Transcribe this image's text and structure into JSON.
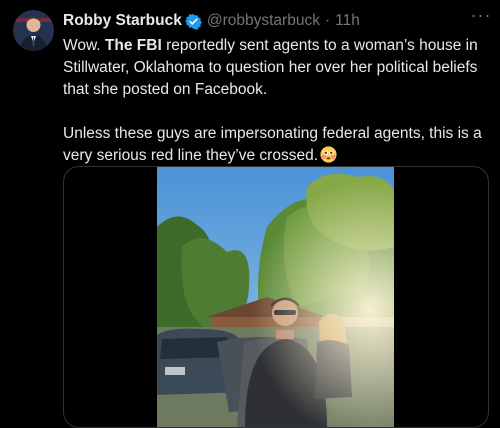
{
  "tweet": {
    "author_name": "Robby Starbuck",
    "handle": "@robbystarbuck",
    "separator": "·",
    "time": "11h",
    "more_icon": "more-horizontal-icon",
    "paragraph1_prefix": "Wow. ",
    "paragraph1_bold": "The FBI",
    "paragraph1_suffix": " reportedly sent agents to a woman’s house in Stillwater, Oklahoma to question her over her political beliefs that she posted on Facebook.",
    "paragraph2": "Unless these guys are impersonating federal agents, this is a very serious red line they’ve crossed.",
    "emoji": "flushed-face-emoji",
    "verified_color": "#1d9bf0"
  },
  "media": {
    "type": "video",
    "icon": "video-thumbnail"
  }
}
